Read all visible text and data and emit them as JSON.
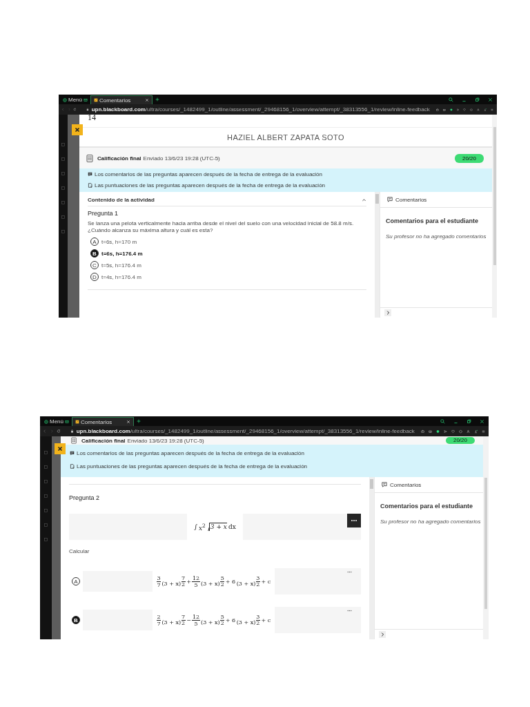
{
  "screenshots": [
    {
      "browser": {
        "tabs": [
          {
            "label": "Menú",
            "selected": false
          },
          {
            "label": "Comentarios",
            "selected": true
          }
        ],
        "url": "**upn.blackboard.com**/ultra/courses/_1482499_1/outline/assessment/_29468156_1/overview/attempt/_38313556_1/review/inline-feedback"
      },
      "page_number": "14",
      "student_name": "HAZIEL ALBERT ZAPATA SOTO",
      "grade": {
        "label": "Calificación final",
        "submitted": "Enviado 13/6/23 19:28 (UTC-5)",
        "score": "20/20"
      },
      "notices": [
        "Los comentarios de las preguntas aparecen después de la fecha de entrega de la evaluación",
        "Las puntuaciones de las preguntas aparecen después de la fecha de entrega de la evaluación"
      ],
      "content": {
        "section": "Contenido de la actividad",
        "question": "Pregunta 1",
        "prompt": "Se lanza una pelota verticalmente hacia arriba desde el nivel del suelo con una velocidad inicial de 58.8 m/s. ¿Cuándo alcanza su máxima altura y cuál es esta?",
        "options": [
          {
            "letter": "A",
            "text": "t=6s, h=170 m",
            "selected": false
          },
          {
            "letter": "B",
            "text": "t=6s, h=176.4 m",
            "selected": true
          },
          {
            "letter": "C",
            "text": "t=5s, h=176.4 m",
            "selected": false
          },
          {
            "letter": "D",
            "text": "t=4s, h=176.4 m",
            "selected": false
          }
        ]
      },
      "comments": {
        "header": "Comentarios",
        "title": "Comentarios para el estudiante",
        "empty": "Su profesor no ha agregado comentarios"
      }
    },
    {
      "browser": {
        "tabs": [
          {
            "label": "Menú",
            "selected": false
          },
          {
            "label": "Comentarios",
            "selected": true
          }
        ],
        "url": "**upn.blackboard.com**/ultra/courses/_1482499_1/outline/assessment/_29468156_1/overview/attempt/_38313556_1/review/inline-feedback"
      },
      "grade": {
        "label": "Calificación final",
        "submitted": "Enviado 13/6/23 19:28 (UTC-5)",
        "score": "20/20"
      },
      "notices": [
        "Los comentarios de las preguntas aparecen después de la fecha de entrega de la evaluación",
        "Las puntuaciones de las preguntas aparecen después de la fecha de entrega de la evaluación"
      ],
      "content": {
        "question": "Pregunta 2",
        "formula": [
          {
            "kind": "text",
            "text": "∫"
          },
          {
            "kind": "sup",
            "base": "x",
            "exp": "2"
          },
          {
            "kind": "sqrt",
            "text": "3 + x"
          },
          {
            "kind": "text",
            "text": "dx"
          }
        ],
        "instruction": "Calcular",
        "options": [
          {
            "letter": "A",
            "selected": false,
            "formula": [
              {
                "kind": "frac",
                "num": "3",
                "den": "7"
              },
              {
                "kind": "pow",
                "base": "(3 + x)",
                "num": "7",
                "den": "2"
              },
              {
                "kind": "text",
                "text": "+"
              },
              {
                "kind": "frac",
                "num": "12",
                "den": "5"
              },
              {
                "kind": "pow",
                "base": "(3 + x)",
                "num": "5",
                "den": "2"
              },
              {
                "kind": "text",
                "text": "+ 6"
              },
              {
                "kind": "pow",
                "base": "(3 + x)",
                "num": "3",
                "den": "2"
              },
              {
                "kind": "text",
                "text": "+ c"
              }
            ]
          },
          {
            "letter": "B",
            "selected": true,
            "formula": [
              {
                "kind": "frac",
                "num": "2",
                "den": "7"
              },
              {
                "kind": "pow",
                "base": "(3 + x)",
                "num": "7",
                "den": "2"
              },
              {
                "kind": "text",
                "text": "−"
              },
              {
                "kind": "frac",
                "num": "12",
                "den": "5"
              },
              {
                "kind": "pow",
                "base": "(3 + x)",
                "num": "5",
                "den": "2"
              },
              {
                "kind": "text",
                "text": "+ 6"
              },
              {
                "kind": "pow",
                "base": "(3 + x)",
                "num": "3",
                "den": "2"
              },
              {
                "kind": "text",
                "text": "+ c"
              }
            ]
          }
        ]
      },
      "comments": {
        "header": "Comentarios",
        "title": "Comentarios para el estudiante",
        "empty": "Su profesor no ha agregado comentarios"
      }
    }
  ]
}
